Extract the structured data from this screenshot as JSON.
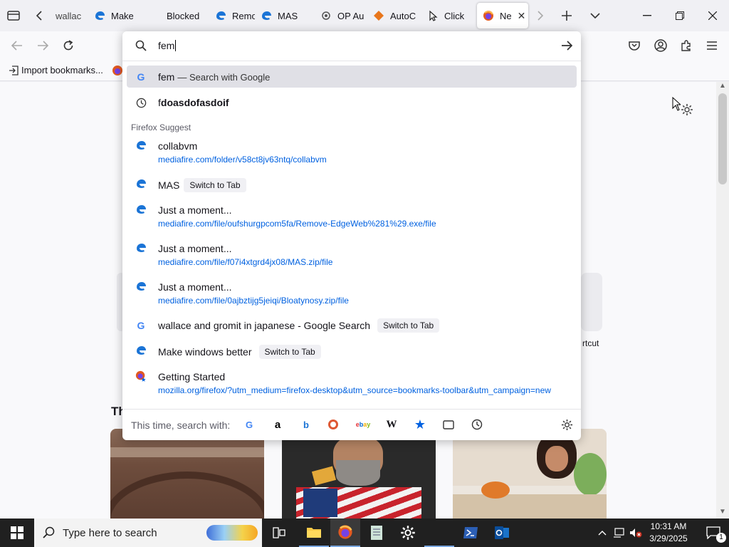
{
  "tabs": [
    {
      "label": "wallac",
      "icon": "google-icon"
    },
    {
      "label": "Make",
      "icon": "edge-icon"
    },
    {
      "label": "Blocked",
      "icon": "none"
    },
    {
      "label": "Remo",
      "icon": "edge-icon"
    },
    {
      "label": "MAS",
      "icon": "edge-icon"
    },
    {
      "label": "OP Au",
      "icon": "openai-icon"
    },
    {
      "label": "AutoC",
      "icon": "autoclicker-icon"
    },
    {
      "label": "Click",
      "icon": "cursor-icon"
    },
    {
      "label": "Ne",
      "icon": "firefox-icon",
      "active": true
    }
  ],
  "bookmarks": {
    "import_label": "Import bookmarks..."
  },
  "urlbar": {
    "query": "fem",
    "heuristic": {
      "query": "fem",
      "suffix": "— Search with Google"
    },
    "history": {
      "prefix": "f",
      "bold": "doasdofasdoif"
    },
    "group_label": "Firefox Suggest",
    "results": [
      {
        "title": "collabvm",
        "url": "mediafire.com/folder/v58ct8jv63ntq/collabvm"
      },
      {
        "title": "MAS",
        "action": "Switch to Tab"
      },
      {
        "title": "Just a moment...",
        "url": "mediafire.com/file/oufshurgpcom5fa/Remove-EdgeWeb%281%29.exe/file"
      },
      {
        "title": "Just a moment...",
        "url": "mediafire.com/file/f07i4xtgrd4jx08/MAS.zip/file"
      },
      {
        "title": "Just a moment...",
        "url": "mediafire.com/file/0ajbztijg5jeiqi/Bloatynosy.zip/file"
      },
      {
        "title": "wallace and gromit in japanese - Google Search",
        "action": "Switch to Tab"
      },
      {
        "title": "Make windows better",
        "action": "Switch to Tab"
      },
      {
        "title": "Getting Started",
        "url": "mozilla.org/firefox/?utm_medium=firefox-desktop&utm_source=bookmarks-toolbar&utm_campaign=new"
      }
    ],
    "oneoff_label": "This time, search with:",
    "engines": [
      "google-icon",
      "amazon-icon",
      "bing-icon",
      "duckduckgo-icon",
      "ebay-icon",
      "wikipedia-icon",
      "bookmarks-icon",
      "tabs-icon",
      "history-icon"
    ]
  },
  "page": {
    "heading_fragment": "Th",
    "shortcut_fragment": "rtcut"
  },
  "taskbar": {
    "search_placeholder": "Type here to search",
    "time": "10:31 AM",
    "date": "3/29/2025",
    "notification_count": "1"
  }
}
